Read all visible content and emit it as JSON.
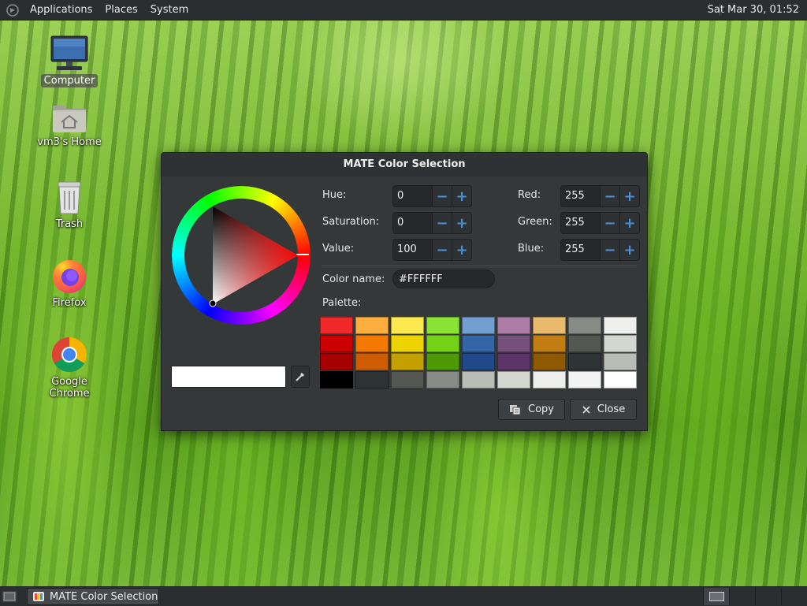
{
  "top_panel": {
    "menus": [
      "Applications",
      "Places",
      "System"
    ],
    "clock": "Sat Mar 30, 01:52"
  },
  "desktop": {
    "icons": [
      {
        "label": "Computer",
        "icon": "computer-icon"
      },
      {
        "label": "vm3's Home",
        "icon": "home-folder-icon"
      },
      {
        "label": "Trash",
        "icon": "trash-icon"
      },
      {
        "label": "Firefox",
        "icon": "firefox-icon"
      },
      {
        "label": "Google Chrome",
        "icon": "chrome-icon"
      }
    ]
  },
  "dialog": {
    "title": "MATE Color Selection",
    "fields": {
      "hue": {
        "label": "Hue:",
        "value": "0"
      },
      "saturation": {
        "label": "Saturation:",
        "value": "0"
      },
      "value": {
        "label": "Value:",
        "value": "100"
      },
      "red": {
        "label": "Red:",
        "value": "255"
      },
      "green": {
        "label": "Green:",
        "value": "255"
      },
      "blue": {
        "label": "Blue:",
        "value": "255"
      }
    },
    "color_name_label": "Color name:",
    "color_name_value": "#FFFFFF",
    "palette_label": "Palette:",
    "palette": [
      [
        "#ef2929",
        "#fcaf3e",
        "#fce94f",
        "#8ae234",
        "#729fcf",
        "#ad7fa8",
        "#e9b96e",
        "#888a85",
        "#eeeeec"
      ],
      [
        "#cc0000",
        "#f57900",
        "#edd400",
        "#73d216",
        "#3465a4",
        "#75507b",
        "#c17d11",
        "#555753",
        "#d3d7cf"
      ],
      [
        "#a40000",
        "#ce5c00",
        "#c4a000",
        "#4e9a06",
        "#204a87",
        "#5c3566",
        "#8f5902",
        "#2e3436",
        "#babdb6"
      ],
      [
        "#000000",
        "#2e3436",
        "#555753",
        "#888a85",
        "#babdb6",
        "#d3d7cf",
        "#eeeeec",
        "#f3f3f3",
        "#ffffff"
      ]
    ],
    "current_color": "#FFFFFF",
    "copy_label": "Copy",
    "close_label": "Close"
  },
  "bottom_panel": {
    "task_label": "MATE Color Selection"
  }
}
